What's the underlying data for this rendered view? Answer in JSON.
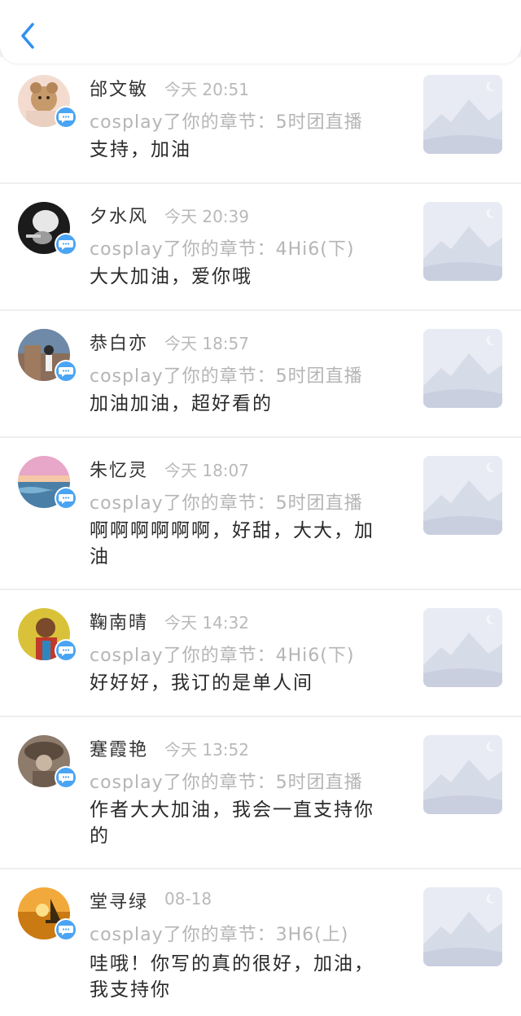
{
  "header": {
    "back_icon": "chevron-left-icon",
    "accent": "#2f8ff0"
  },
  "items": [
    {
      "name": "邰文敏",
      "time": "今天 20:51",
      "sub": "cosplay了你的章节：5时团直播",
      "message": "支持，加油",
      "avatar_theme": "teddy-bear"
    },
    {
      "name": "夕水风",
      "time": "今天 20:39",
      "sub": "cosplay了你的章节：4Hi6(下)",
      "message": "大大加油，爱你哦",
      "avatar_theme": "dark-photo"
    },
    {
      "name": "恭白亦",
      "time": "今天 18:57",
      "sub": "cosplay了你的章节：5时团直播",
      "message": "加油加油，超好看的",
      "avatar_theme": "wall-photo"
    },
    {
      "name": "朱忆灵",
      "time": "今天 18:07",
      "sub": "cosplay了你的章节：5时团直播",
      "message": "啊啊啊啊啊啊，好甜，大大，加油",
      "avatar_theme": "sunset-sea"
    },
    {
      "name": "鞠南晴",
      "time": "今天 14:32",
      "sub": "cosplay了你的章节：4Hi6(下)",
      "message": "好好好，我订的是单人间",
      "avatar_theme": "colorful-girl"
    },
    {
      "name": "蹇霞艳",
      "time": "今天 13:52",
      "sub": "cosplay了你的章节：5时团直播",
      "message": "作者大大加油，我会一直支持你的",
      "avatar_theme": "sepia-figure"
    },
    {
      "name": "堂寻绿",
      "time": "08-18",
      "sub": "cosplay了你的章节：3H6(上)",
      "message": "哇哦！你写的真的很好，加油，我支持你",
      "avatar_theme": "sailboat-sunset"
    }
  ],
  "badge_color": "#4aa4f3",
  "badge_icon": "chat-bubble-icon",
  "thumb_icon": "mountain-placeholder-icon"
}
